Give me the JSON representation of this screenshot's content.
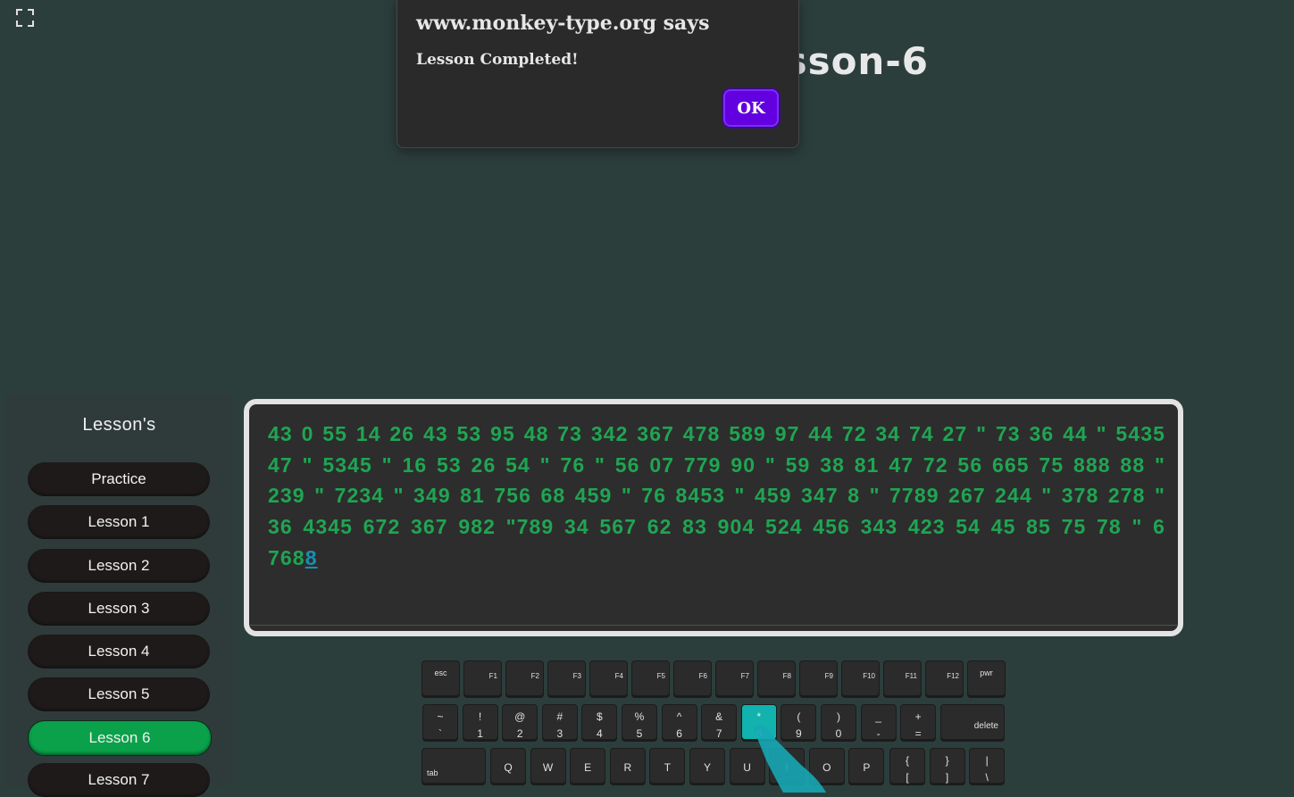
{
  "header": {
    "title_visible": "sson-6"
  },
  "dialog": {
    "host": "www.monkey-type.org says",
    "message": "Lesson Completed!",
    "ok_label": "OK"
  },
  "sidebar": {
    "title": "Lesson's",
    "items": [
      {
        "label": "Practice",
        "active": false
      },
      {
        "label": "Lesson 1",
        "active": false
      },
      {
        "label": "Lesson 2",
        "active": false
      },
      {
        "label": "Lesson 3",
        "active": false
      },
      {
        "label": "Lesson 4",
        "active": false
      },
      {
        "label": "Lesson 5",
        "active": false
      },
      {
        "label": "Lesson 6",
        "active": true
      },
      {
        "label": "Lesson 7",
        "active": false
      }
    ]
  },
  "typing": {
    "typed": "43 0 55 14 26 43 53 95 48 73 342 367 478 589 97 44 72 34 74 27 \" 73 36 44 \" 5435 47 \" 5345 \" 16 53 26 54 \" 76 \" 56 07 779 90 \" 59 38 81 47 72 56 665 75 888 88 \" 239 \" 7234 \" 349 81 756 68 459 \" 76 8453 \" 459 347 8 \" 7789 267 244 \" 378 278 \" 36 4345 672 367 982 \"789 34 567 62 83 904 524 456 343 423 54 45 85 75 78 \" 6 768",
    "current_char": "8"
  },
  "keyboard": {
    "fn_row": [
      "esc",
      "F1",
      "F2",
      "F3",
      "F4",
      "F5",
      "F6",
      "F7",
      "F8",
      "F9",
      "F10",
      "F11",
      "F12",
      "pwr"
    ],
    "num_row": [
      {
        "top": "~",
        "bot": "`"
      },
      {
        "top": "!",
        "bot": "1"
      },
      {
        "top": "@",
        "bot": "2"
      },
      {
        "top": "#",
        "bot": "3"
      },
      {
        "top": "$",
        "bot": "4"
      },
      {
        "top": "%",
        "bot": "5"
      },
      {
        "top": "^",
        "bot": "6"
      },
      {
        "top": "&",
        "bot": "7"
      },
      {
        "top": "*",
        "bot": "8"
      },
      {
        "top": "(",
        "bot": "9"
      },
      {
        "top": ")",
        "bot": "0"
      },
      {
        "top": "_",
        "bot": "-"
      },
      {
        "top": "+",
        "bot": "="
      }
    ],
    "delete_label": "delete",
    "tab_label": "tab",
    "qwerty_row": [
      "Q",
      "W",
      "E",
      "R",
      "T",
      "Y",
      "U",
      "I",
      "O",
      "P"
    ],
    "bracket_keys": [
      {
        "top": "{",
        "bot": "["
      },
      {
        "top": "}",
        "bot": "]"
      },
      {
        "top": "|",
        "bot": "\\"
      }
    ],
    "highlight_key": "8",
    "highlight_color": "#12b3ae"
  },
  "colors": {
    "background": "#2c3e3c",
    "typed_text": "#1fa552",
    "active_lesson": "#0aa14a",
    "ok_button": "#6300e0"
  }
}
